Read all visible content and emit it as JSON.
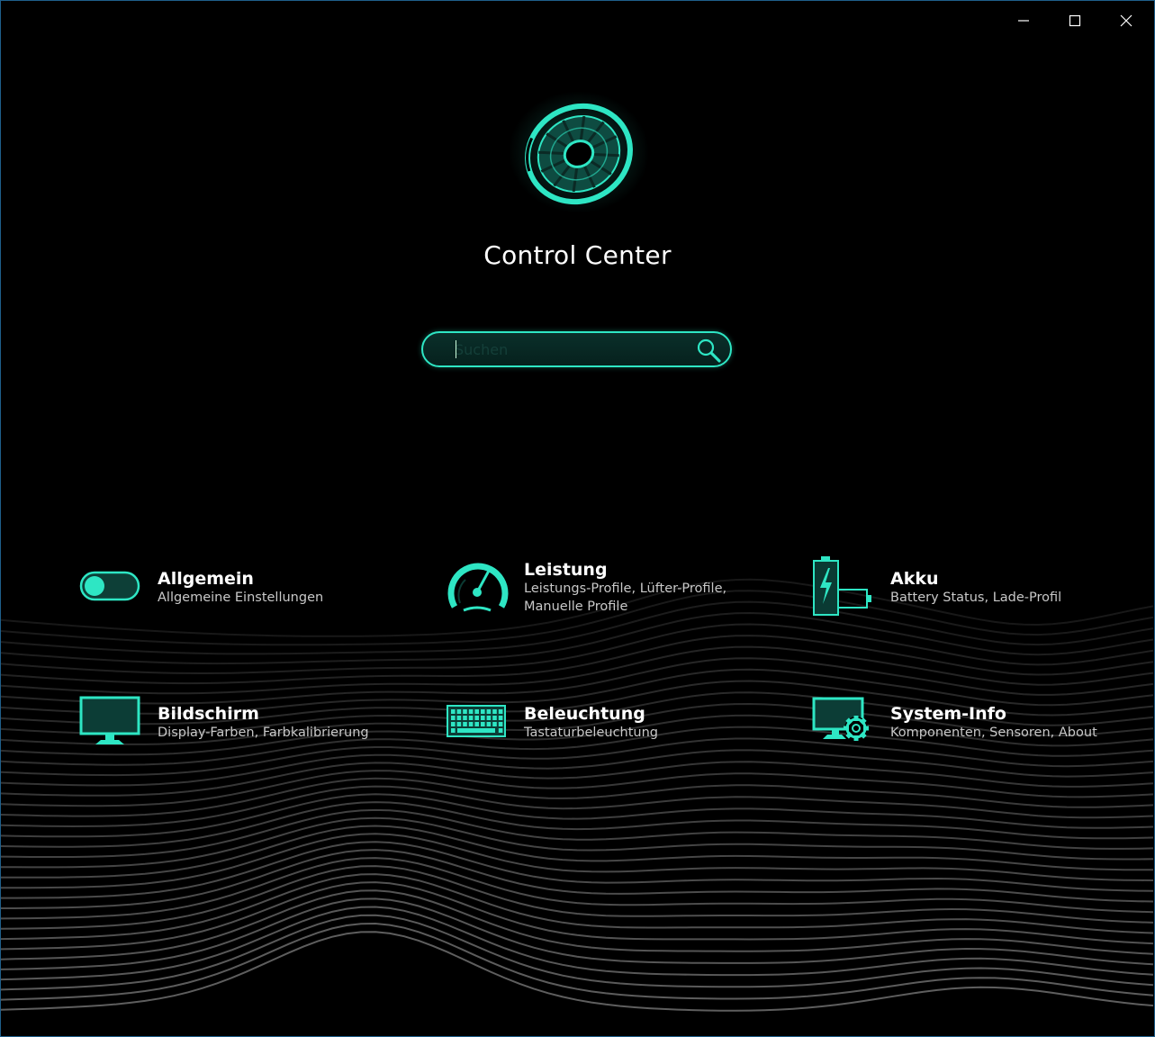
{
  "window": {
    "minimize_icon": "minimize-icon",
    "maximize_icon": "maximize-icon",
    "close_icon": "close-icon"
  },
  "app": {
    "title": "Control Center",
    "logo_icon": "fan-logo-icon",
    "accent_color": "#2ee6c4"
  },
  "search": {
    "placeholder": "Suchen",
    "value": "",
    "icon": "search-icon"
  },
  "tiles": [
    {
      "title": "Allgemein",
      "desc": "Allgemeine Einstellungen",
      "icon": "toggle-icon"
    },
    {
      "title": "Leistung",
      "desc": "Leistungs-Profile, Lüfter-Profile, Manuelle Profile",
      "icon": "speedometer-icon"
    },
    {
      "title": "Akku",
      "desc": "Battery Status, Lade-Profil",
      "icon": "battery-icon"
    },
    {
      "title": "Bildschirm",
      "desc": "Display-Farben, Farbkalibrierung",
      "icon": "monitor-icon"
    },
    {
      "title": "Beleuchtung",
      "desc": "Tastaturbeleuchtung",
      "icon": "keyboard-icon"
    },
    {
      "title": "System-Info",
      "desc": "Komponenten, Sensoren, About",
      "icon": "monitor-gear-icon"
    }
  ]
}
